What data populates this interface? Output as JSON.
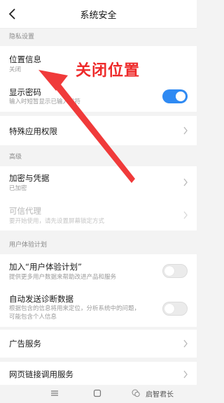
{
  "header": {
    "title": "系统安全"
  },
  "sections": {
    "privacy": {
      "header": "隐私设置",
      "location": {
        "title": "位置信息",
        "subtitle": "关闭"
      },
      "show_password": {
        "title": "显示密码",
        "subtitle": "输入时短暂显示已输入字符",
        "enabled": true
      },
      "special_access": {
        "title": "特殊应用权限"
      }
    },
    "advanced": {
      "header": "高级",
      "encryption": {
        "title": "加密与凭据",
        "subtitle": "已加密"
      },
      "trust_agents": {
        "title": "可信代理",
        "subtitle": "要开始使用，请先设置屏幕锁定方式"
      }
    },
    "ux_program": {
      "header": "用户体验计划",
      "join": {
        "title": "加入“用户体验计划”",
        "subtitle": "提供更多用户数据来帮助改进产品和服务",
        "enabled": false
      },
      "diagnostics": {
        "title": "自动发送诊断数据",
        "subtitle_line1": "根据包含的信息将用来定位，分析系统中的问题，",
        "subtitle_line2": "可能包含个人信息",
        "enabled": false
      },
      "ads": {
        "title": "广告服务"
      },
      "web_link": {
        "title": "网页链接调用服务"
      }
    }
  },
  "annotation": {
    "text": "关闭位置",
    "color": "#ee2a2a"
  },
  "watermark": {
    "text": "启智君长"
  },
  "colors": {
    "accent": "#2f8af3",
    "background": "#f3f3f3"
  }
}
